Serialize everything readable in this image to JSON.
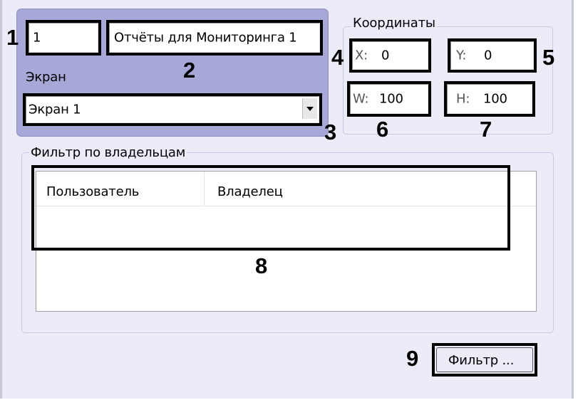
{
  "form": {
    "id_value": "1",
    "name_value": "Отчёты для Мониторинга 1",
    "screen_label": "Экран",
    "screen_selected": "Экран 1"
  },
  "coordinates": {
    "legend": "Координаты",
    "x": {
      "label": "X:",
      "value": "0"
    },
    "y": {
      "label": "Y:",
      "value": "0"
    },
    "w": {
      "label": "W:",
      "value": "100"
    },
    "h": {
      "label": "H:",
      "value": "100"
    }
  },
  "owner_filter": {
    "legend": "Фильтр по владельцам",
    "columns": [
      "Пользователь",
      "Владелец"
    ]
  },
  "filter_button_label": "Фильтр ...",
  "callouts": [
    "1",
    "2",
    "3",
    "4",
    "5",
    "6",
    "7",
    "8",
    "9"
  ],
  "icons": {
    "dropdown": "chevron-down-icon"
  }
}
